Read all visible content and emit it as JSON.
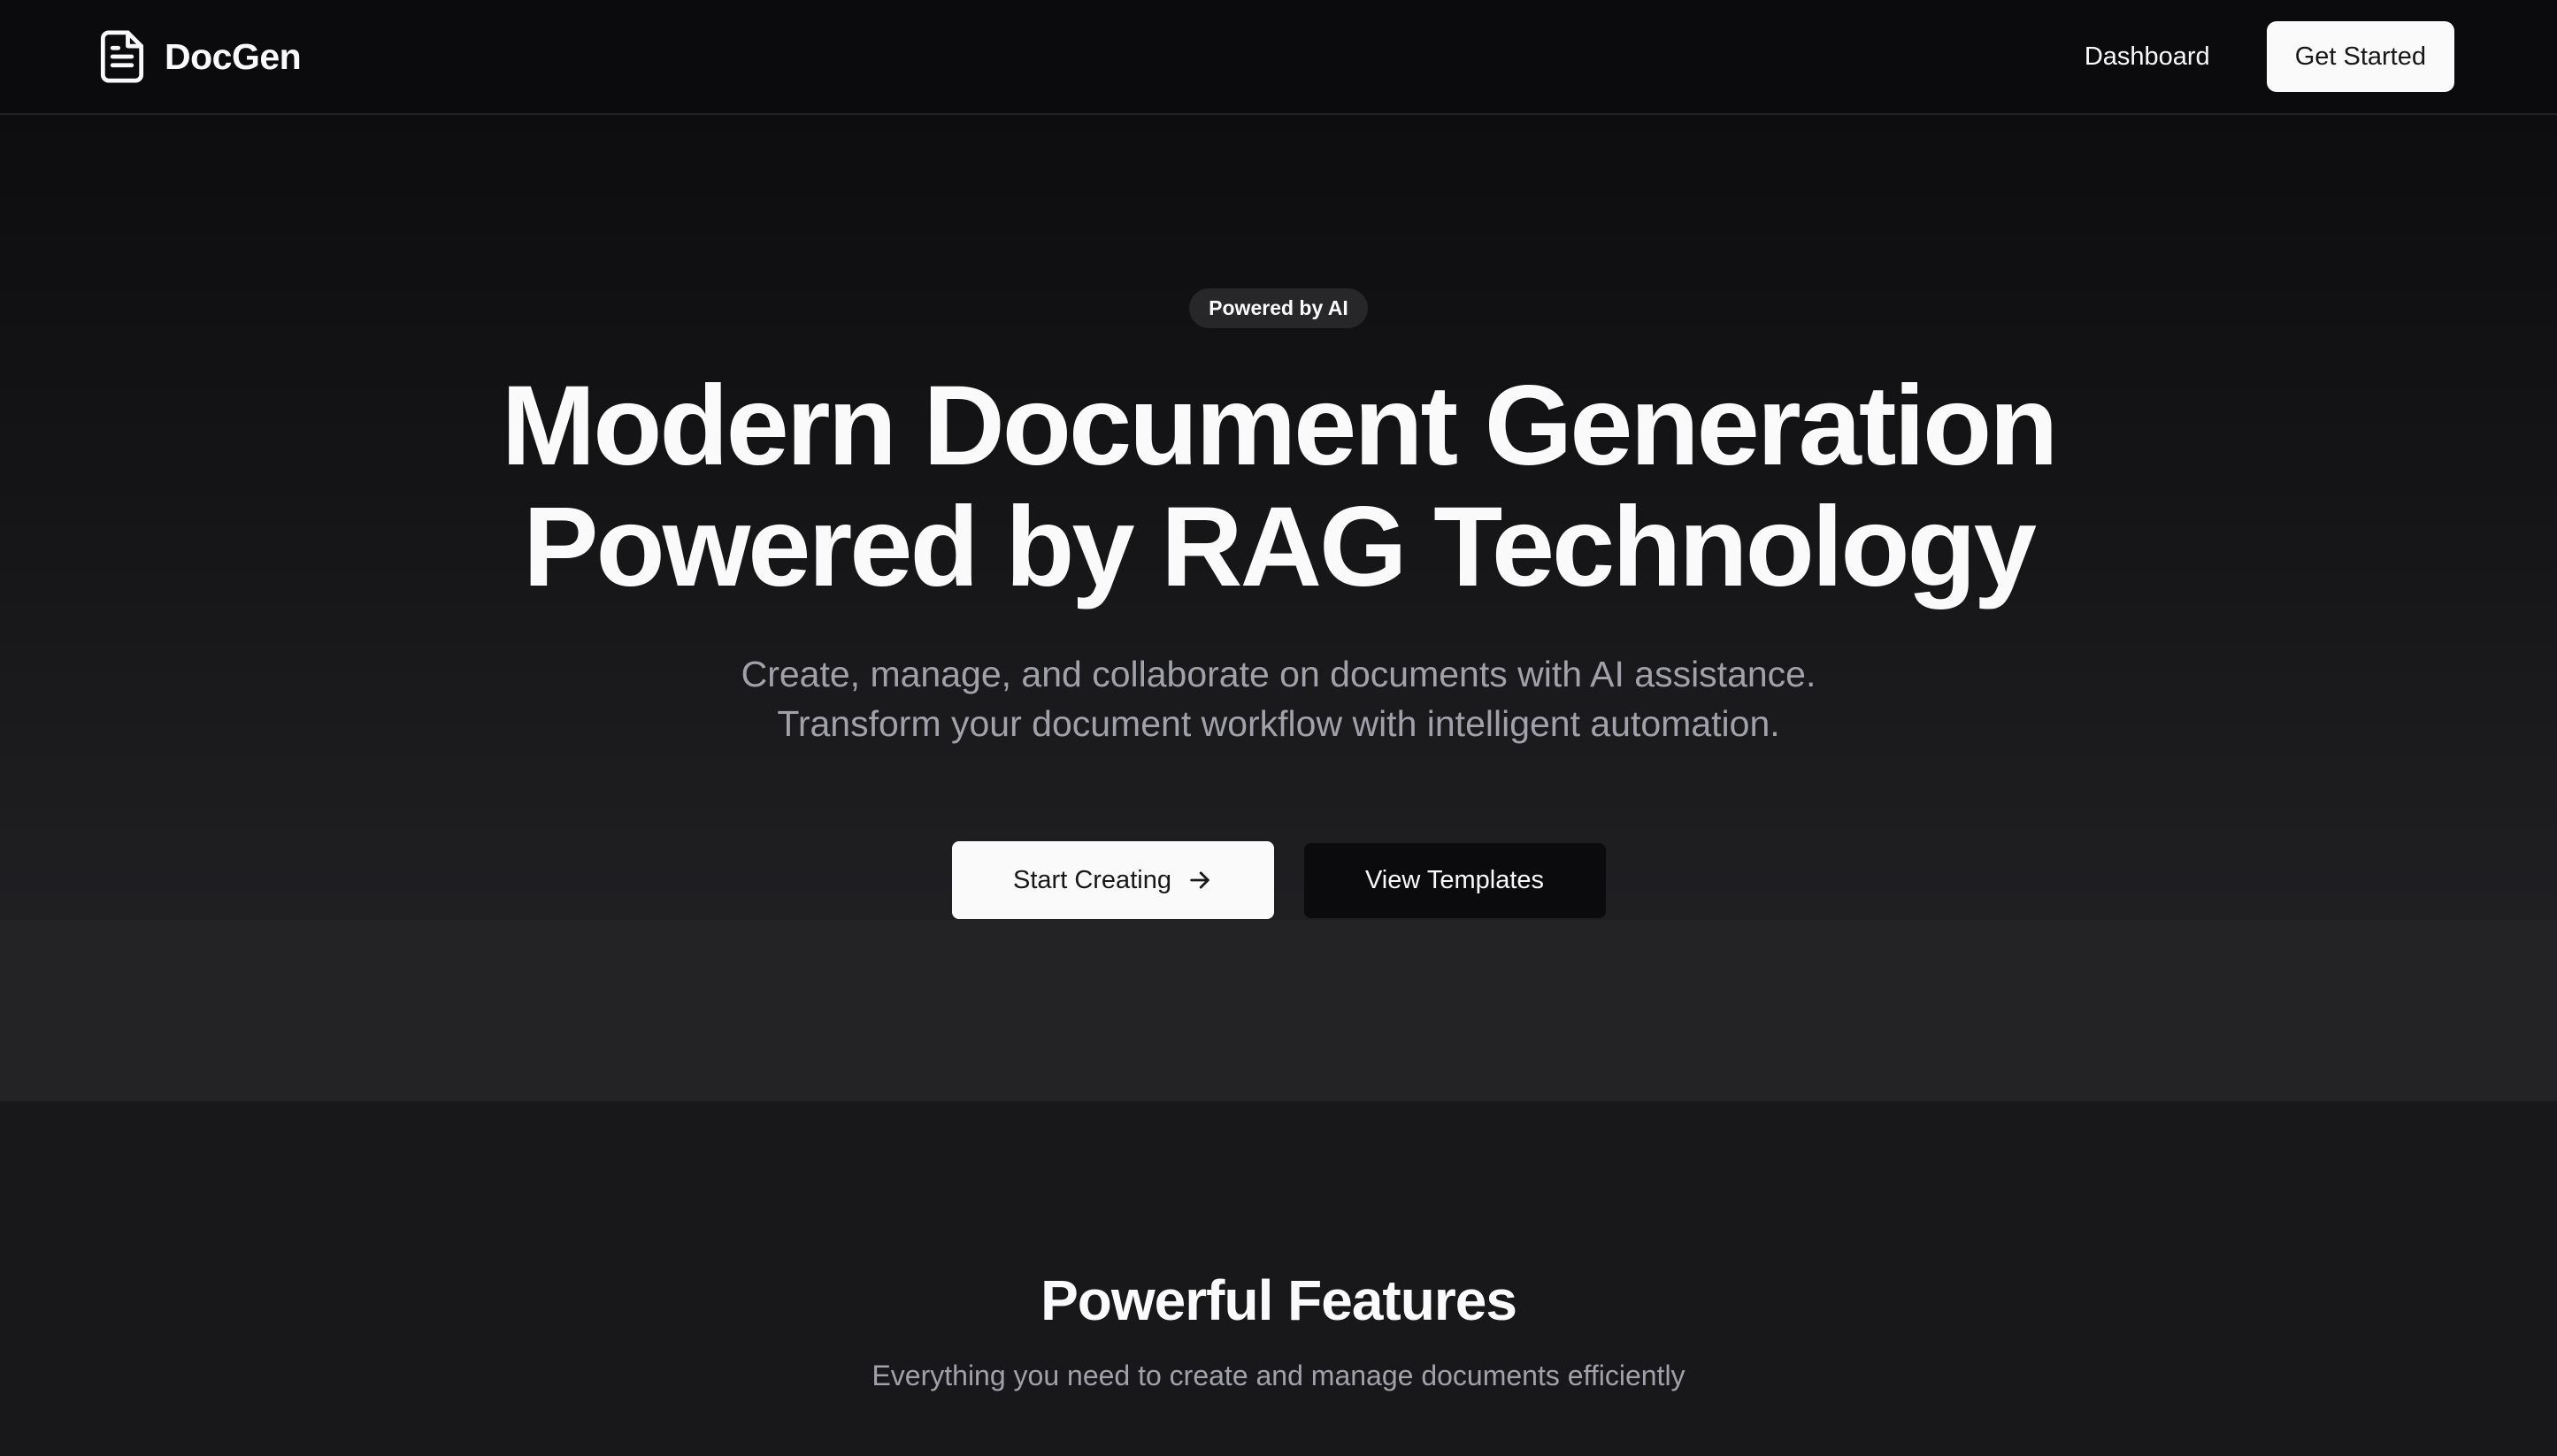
{
  "header": {
    "brand_name": "DocGen",
    "brand_icon": "document-icon",
    "nav_dashboard": "Dashboard",
    "get_started_label": "Get Started"
  },
  "hero": {
    "badge": "Powered by AI",
    "title_line1": "Modern Document Generation",
    "title_line2": "Powered by RAG Technology",
    "subtitle_line1": "Create, manage, and collaborate on documents with AI assistance.",
    "subtitle_line2": "Transform your document workflow with intelligent automation.",
    "primary_cta": "Start Creating",
    "primary_cta_icon": "arrow-right-icon",
    "secondary_cta": "View Templates"
  },
  "features": {
    "title": "Powerful Features",
    "subtitle": "Everything you need to create and manage documents efficiently"
  },
  "colors": {
    "background": "#18181b",
    "header_bg": "#0b0b0d",
    "text_primary": "#fafafa",
    "text_muted": "#a1a1aa",
    "badge_bg": "#27272a"
  }
}
